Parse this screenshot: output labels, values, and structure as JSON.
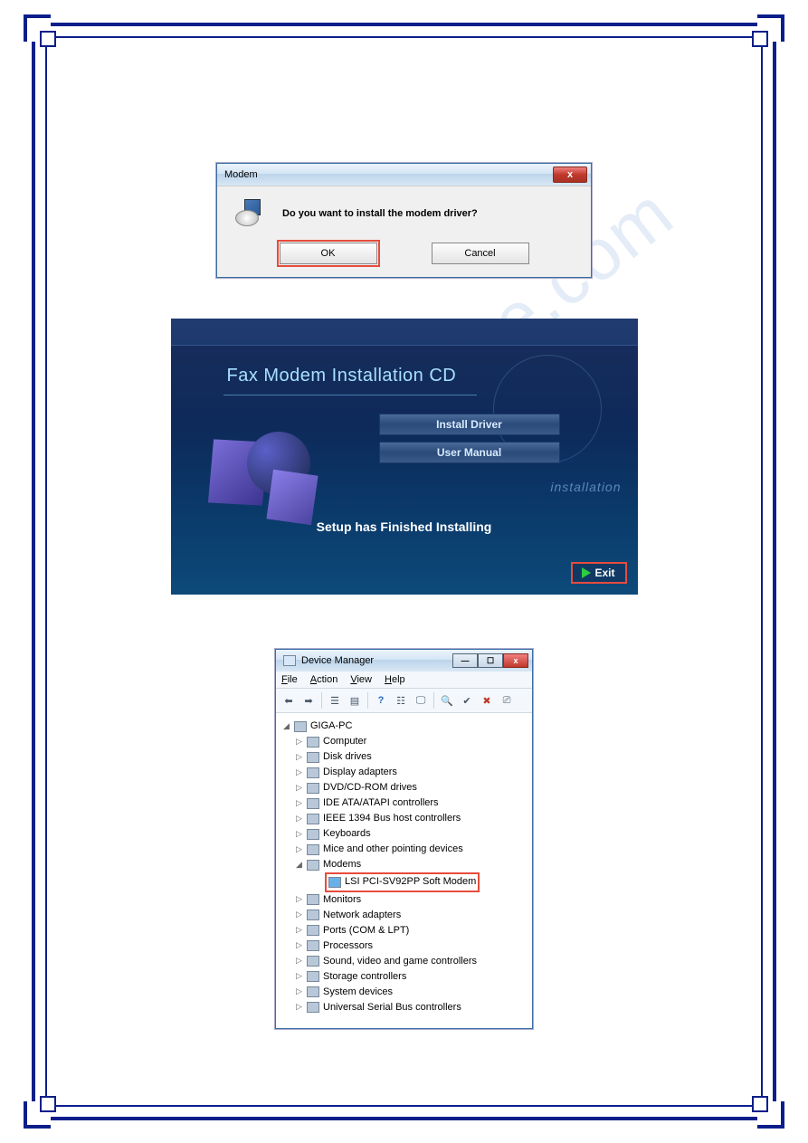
{
  "watermark": "manualshive.com",
  "modem_dialog": {
    "title": "Modem",
    "message": "Do you want to install the modem driver?",
    "ok_label": "OK",
    "cancel_label": "Cancel",
    "close_glyph": "x"
  },
  "installer": {
    "title": "Fax Modem Installation CD",
    "button_install": "Install Driver",
    "button_manual": "User Manual",
    "side_text": "installation",
    "status": "Setup has Finished Installing",
    "exit_label": "Exit"
  },
  "device_manager": {
    "title": "Device Manager",
    "menu": {
      "file": "File",
      "action": "Action",
      "view": "View",
      "help": "Help"
    },
    "toolbar_icons": [
      "back-arrow-icon",
      "forward-arrow-icon",
      "up-icon",
      "properties-icon",
      "help-icon",
      "tree-icon",
      "list-icon",
      "scan-icon",
      "refresh-icon",
      "stop-icon",
      "monitor-icon"
    ],
    "root": "GIGA-PC",
    "nodes": [
      {
        "label": "Computer"
      },
      {
        "label": "Disk drives"
      },
      {
        "label": "Display adapters"
      },
      {
        "label": "DVD/CD-ROM drives"
      },
      {
        "label": "IDE ATA/ATAPI controllers"
      },
      {
        "label": "IEEE 1394 Bus host controllers"
      },
      {
        "label": "Keyboards"
      },
      {
        "label": "Mice and other pointing devices"
      },
      {
        "label": "Modems",
        "expanded": true,
        "children": [
          {
            "label": "LSI PCI-SV92PP Soft Modem",
            "highlight": true
          }
        ]
      },
      {
        "label": "Monitors"
      },
      {
        "label": "Network adapters"
      },
      {
        "label": "Ports (COM & LPT)"
      },
      {
        "label": "Processors"
      },
      {
        "label": "Sound, video and game controllers"
      },
      {
        "label": "Storage controllers"
      },
      {
        "label": "System devices"
      },
      {
        "label": "Universal Serial Bus controllers"
      }
    ]
  }
}
